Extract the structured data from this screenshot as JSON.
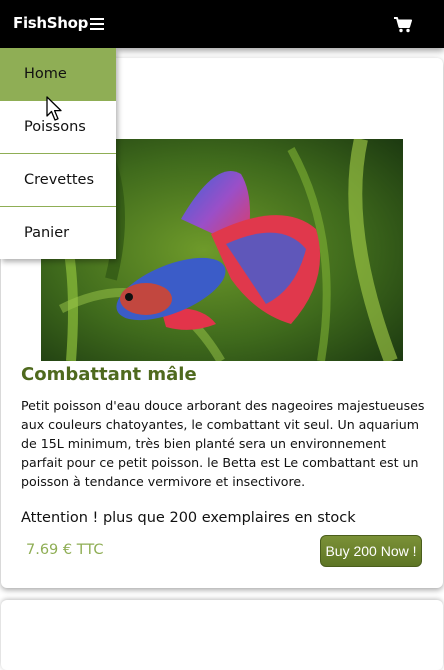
{
  "header": {
    "brand": "FishShop",
    "menu_icon": "hamburger-icon",
    "cart_icon": "cart-icon"
  },
  "nav_menu": {
    "items": [
      {
        "label": "Home",
        "active": true
      },
      {
        "label": "Poissons",
        "active": false
      },
      {
        "label": "Crevettes",
        "active": false
      },
      {
        "label": "Panier",
        "active": false
      }
    ]
  },
  "product": {
    "title": "Combattant mâle",
    "description": "Petit poisson d'eau douce arborant des nageoires majestueuses aux couleurs chatoyantes, le combattant vit seul. Un aquarium de 15L minimum, très bien planté sera un environnement parfait pour ce petit poisson. le Betta est Le combattant est un poisson à tendance vermivore et insectivore.",
    "stock_text": "Attention ! plus que 200 exemplaires en stock",
    "price": "7.69 € TTC",
    "buy_label": "Buy 200 Now !"
  },
  "colors": {
    "header_bg": "#000000",
    "accent_green": "#8fae55",
    "title_green": "#4f6a1e",
    "button_green": "#6b8230"
  }
}
